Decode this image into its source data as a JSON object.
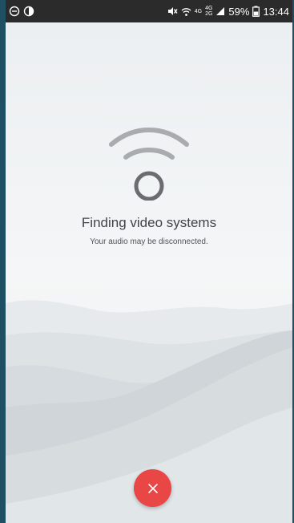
{
  "status_bar": {
    "time": "13:44",
    "battery": "59%",
    "network_top": "4G",
    "network_bottom": "2G",
    "network_label": "4G"
  },
  "main": {
    "title": "Finding video systems",
    "subtitle": "Your audio may be disconnected."
  },
  "icons": {
    "left": [
      "do-not-disturb-icon",
      "theme-icon"
    ],
    "right": [
      "mute-icon",
      "wifi-icon",
      "signal-icon",
      "battery-icon"
    ],
    "center": "searching-wifi-icon",
    "cancel": "close-icon"
  },
  "colors": {
    "accent_red": "#e94646",
    "status_bar": "#2b2b2b",
    "text_primary": "#404447",
    "graphic_arcs": "#a9acaf",
    "graphic_ring": "#6a6d70"
  }
}
